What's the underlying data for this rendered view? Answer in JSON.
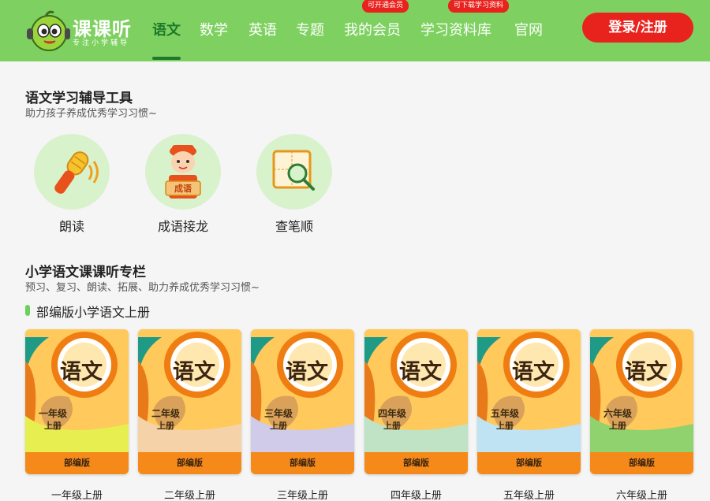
{
  "header": {
    "logo_text": "课课听",
    "logo_sub": "专注小学辅导",
    "nav": [
      {
        "label": "语文",
        "active": true
      },
      {
        "label": "数学"
      },
      {
        "label": "英语"
      },
      {
        "label": "专题"
      },
      {
        "label": "我的会员",
        "badge": "可开通会员"
      },
      {
        "label": "学习资料库",
        "badge": "可下载学习资料"
      },
      {
        "label": "官网"
      }
    ],
    "login_label": "登录/注册"
  },
  "tools_section": {
    "title": "语文学习辅导工具",
    "subtitle": "助力孩子养成优秀学习习惯~",
    "tools": [
      {
        "label": "朗读",
        "icon": "microphone-icon"
      },
      {
        "label": "成语接龙",
        "icon": "idiom-kid-icon",
        "icon_text": "成语"
      },
      {
        "label": "查笔顺",
        "icon": "magnifier-character-icon"
      }
    ]
  },
  "column_section": {
    "title": "小学语文课课听专栏",
    "subtitle": "预习、复习、朗读、拓展、助力养成优秀学习习惯~",
    "edition_heading": "部编版小学语文上册",
    "books": [
      {
        "title": "语文",
        "grade": "一年级",
        "volume": "上册",
        "edition": "部编版",
        "caption": "一年级上册",
        "accent": "#e6ef4f"
      },
      {
        "title": "语文",
        "grade": "二年级",
        "volume": "上册",
        "edition": "部编版",
        "caption": "二年级上册",
        "accent": "#f5d2a8"
      },
      {
        "title": "语文",
        "grade": "三年级",
        "volume": "上册",
        "edition": "部编版",
        "caption": "三年级上册",
        "accent": "#cfcbe8"
      },
      {
        "title": "语文",
        "grade": "四年级",
        "volume": "上册",
        "edition": "部编版",
        "caption": "四年级上册",
        "accent": "#bfe3c4"
      },
      {
        "title": "语文",
        "grade": "五年级",
        "volume": "上册",
        "edition": "部编版",
        "caption": "五年级上册",
        "accent": "#bfe3f2"
      },
      {
        "title": "语文",
        "grade": "六年级",
        "volume": "上册",
        "edition": "部编版",
        "caption": "六年级上册",
        "accent": "#8fd26e"
      }
    ]
  },
  "colors": {
    "header_bg": "#7ed160",
    "active_nav": "#1e7a2a",
    "login_bg": "#e8221d",
    "book_orange": "#f58a1a",
    "tool_circle": "#d8f2cc"
  }
}
